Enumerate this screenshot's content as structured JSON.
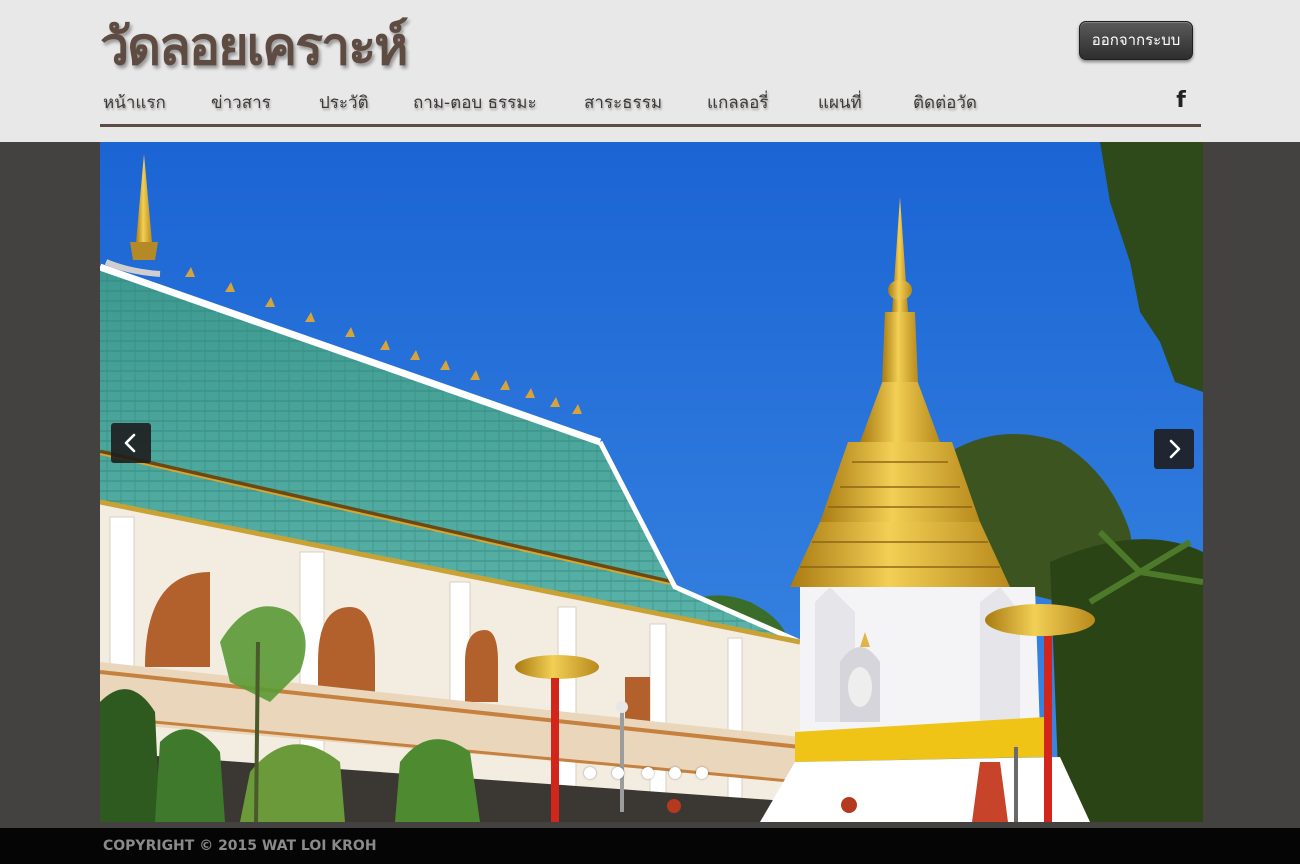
{
  "site": {
    "title": "วัดลอยเคราะห์",
    "logout_label": "ออกจากระบบ"
  },
  "nav": {
    "items": [
      {
        "label": "หน้าแรก"
      },
      {
        "label": "ข่าวสาร"
      },
      {
        "label": "ประวัติ"
      },
      {
        "label": "ถาม-ตอบ ธรรมะ"
      },
      {
        "label": "สาระธรรม"
      },
      {
        "label": "แกลลอรี่"
      },
      {
        "label": "แผนที่"
      },
      {
        "label": "ติดต่อวัด"
      }
    ],
    "social_icon": "facebook-icon",
    "social_glyph": "f"
  },
  "slider": {
    "slide_count": 5,
    "active_slide": 1,
    "prev_icon": "chevron-left-icon",
    "next_icon": "chevron-right-icon"
  },
  "footer": {
    "copyright": "COPYRIGHT © 2015 WAT LOI KROH"
  },
  "colors": {
    "header_bg": "#e8e8e8",
    "title_text": "#5e4c42",
    "page_bg": "#444241",
    "footer_bg": "#050505",
    "sky": "#1c6fd6"
  }
}
